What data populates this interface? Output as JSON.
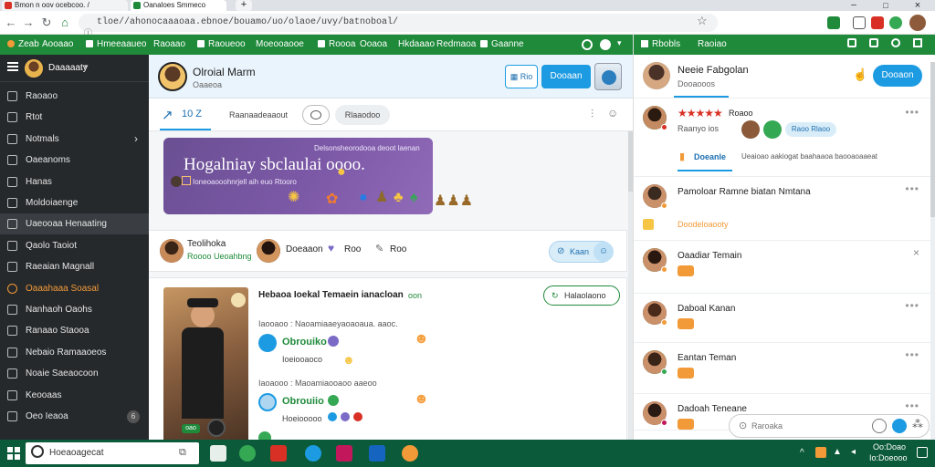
{
  "browser": {
    "tabs": [
      {
        "label": "Bmon n oov ocebcoo. /",
        "color": "#d93025"
      },
      {
        "label": "Oanaloes Smmeco",
        "color": "#1e8a3a"
      }
    ],
    "new_tab": "+",
    "url": "tloe//ahonocaaaoaa.ebnoe/bouamo/uo/olaoe/uvy/batnoboal/",
    "controls": {
      "min": "–",
      "max": "□",
      "close": "×"
    }
  },
  "top_nav": {
    "items": [
      "Zeab",
      "Aooaao",
      "Hmeeaaueo",
      "Raoaao",
      "Raoueoo",
      "Moeooaooe",
      "Roooa",
      "Ooaoa",
      "Hkdaaao",
      "Redmaoa",
      "Gaanne"
    ]
  },
  "sidebar": {
    "header": "Daaaaaty",
    "items": [
      {
        "label": "Raoaoo",
        "style": "normal"
      },
      {
        "label": "Rtot",
        "style": "normal"
      },
      {
        "label": "Notmals",
        "style": "normal",
        "chevron": "›"
      },
      {
        "label": "Oaeanoms",
        "style": "normal"
      },
      {
        "label": "Hanas",
        "style": "normal"
      },
      {
        "label": "Moldoiaenge",
        "style": "normal"
      },
      {
        "label": "Uaeooaa Henaating",
        "style": "active"
      },
      {
        "label": "Qaolo Taoiot",
        "style": "normal"
      },
      {
        "label": "Raeaian Magnall",
        "style": "normal"
      },
      {
        "label": "Oaaahaaa Soasal",
        "style": "orange"
      },
      {
        "label": "Nanhaoh Oaohs",
        "style": "normal"
      },
      {
        "label": "Ranaao Staooa",
        "style": "normal"
      },
      {
        "label": "Nebaio Ramaaoeos",
        "style": "normal"
      },
      {
        "label": "Noaie Saeaocoon",
        "style": "normal"
      },
      {
        "label": "Keooaas",
        "style": "normal"
      },
      {
        "label": "Oeo Ieaoa",
        "style": "normal",
        "badge": "6"
      }
    ]
  },
  "profile": {
    "name": "Olroial Marm",
    "subtitle": "Oaaeoa",
    "btn_small": "Rio",
    "btn_primary": "Dooaan"
  },
  "subtabs": {
    "counter": "10 Z",
    "pill1": "Raanaadeaaout",
    "pill2": "Rlaaodoo"
  },
  "banner": {
    "caption": "Delsonsheorodooa deoot laenan",
    "title": "Hogalniay sbclaulai oooo.",
    "sub": "Ioneoaooohnrjell aih euo Rtooro"
  },
  "post_author": {
    "name": "Teolihoka",
    "sub": "Roooo Ueoahbng",
    "name2": "Doeaaon",
    "count1": "Roo",
    "count2": "Roo",
    "follow": "Kaan"
  },
  "post": {
    "title": "Hebaoa Ioekal Temaein ianacloan",
    "title_tag": "oon",
    "action": "Halaolaono",
    "comment1_meta": "Iaooaoo : Naoamiaaeyaoaoaua. aaoc.",
    "comment1_name": "Obrouiko",
    "comment1_text": "Ioeiooaoco",
    "comment2_meta": "Iaoaooo : Maoamiaooaoo aaeoo",
    "comment2_name": "Obrouiio",
    "comment2_text": "Hoeiooooo",
    "video_tag": "oao"
  },
  "right_panel": {
    "nav_left": "Rbobls",
    "nav_mid": "Raoiao",
    "name": "Neeie Fabgolan",
    "sub": "Dooaooos",
    "follow": "Dooaon",
    "rating_text": "Roaoo",
    "rating_sub": "Raanyo ios",
    "rating_chip": "Raoo Rlaoo",
    "tab_active": "Doeanle",
    "tab_rest": "Ueaioao aakiogat baahaaoa baooaoaaeat",
    "entries": [
      {
        "name": "Pamoloar Ramne biatan Nmtana",
        "sub": "Doodeloaooty",
        "status": "#f29a38"
      },
      {
        "name": "Oaadiar Temain",
        "sub": "",
        "status": "#f29a38"
      },
      {
        "name": "Daboal Kanan",
        "sub": "",
        "status": "#f29a38"
      },
      {
        "name": "Eantan Teman",
        "sub": "",
        "status": "#34a853"
      },
      {
        "name": "Dadoah Teneane",
        "sub": "",
        "status": "#c2185b"
      }
    ],
    "search_placeholder": "Raroaka"
  },
  "taskbar": {
    "search": "Hoeaoagecat",
    "time": "Oo:Doao",
    "date": "Io:Doeooo"
  },
  "colors": {
    "brand_green": "#1e8a3a",
    "accent_blue": "#1d9be2",
    "sidebar": "#26292c",
    "orange": "#f29a38"
  }
}
